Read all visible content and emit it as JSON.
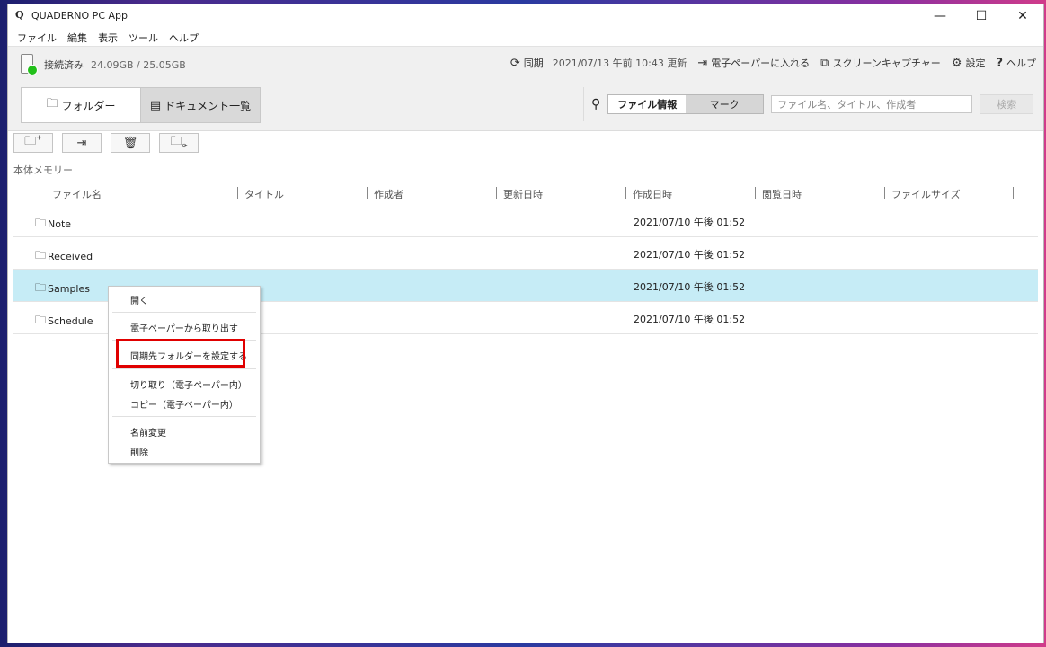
{
  "window": {
    "logo": "Q",
    "title": "QUADERNO PC App",
    "minimize": "—",
    "maximize": "☐",
    "close": "✕"
  },
  "menu": [
    "ファイル",
    "編集",
    "表示",
    "ツール",
    "ヘルプ"
  ],
  "status": {
    "connection": "接続済み",
    "capacity": "24.09GB / 25.05GB",
    "sync_label": "同期",
    "sync_date": "2021/07/13 午前 10:43 更新",
    "import_label": "電子ペーパーに入れる",
    "capture_label": "スクリーンキャプチャー",
    "settings_label": "設定",
    "help_label": "ヘルプ",
    "status_color": "#22c01a"
  },
  "tabs": {
    "folder": "フォルダー",
    "documents": "ドキュメント一覧"
  },
  "search": {
    "seg_info": "ファイル情報",
    "seg_mark": "マーク",
    "placeholder": "ファイル名、タイトル、作成者",
    "button": "検索"
  },
  "section_label": "本体メモリー",
  "columns": [
    "ファイル名",
    "タイトル",
    "作成者",
    "更新日時",
    "作成日時",
    "閲覧日時",
    "ファイルサイズ"
  ],
  "rows": [
    {
      "name": "Note",
      "created": "2021/07/10 午後 01:52",
      "icon": "sync-folder-icon"
    },
    {
      "name": "Received",
      "created": "2021/07/10 午後 01:52",
      "icon": "sync-folder-icon"
    },
    {
      "name": "Samples",
      "created": "2021/07/10 午後 01:52",
      "icon": "folder-icon"
    },
    {
      "name": "Schedule",
      "created": "2021/07/10 午後 01:52",
      "icon": "sync-folder-icon"
    }
  ],
  "context_menu": {
    "open": "開く",
    "export": "電子ペーパーから取り出す",
    "set_sync": "同期先フォルダーを設定する",
    "cut": "切り取り（電子ペーパー内）",
    "copy": "コピー（電子ペーパー内）",
    "rename": "名前変更",
    "delete": "削除"
  },
  "highlight_color": "#e00000",
  "selected_row_color": "#c6ecf6"
}
